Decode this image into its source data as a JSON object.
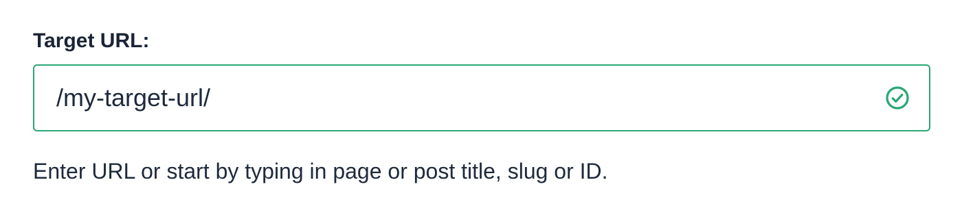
{
  "field": {
    "label": "Target URL:",
    "value": "/my-target-url/",
    "help_text": "Enter URL or start by typing in page or post title, slug or ID.",
    "status_icon": "check-circle-icon",
    "accent_color": "#2aa774"
  }
}
